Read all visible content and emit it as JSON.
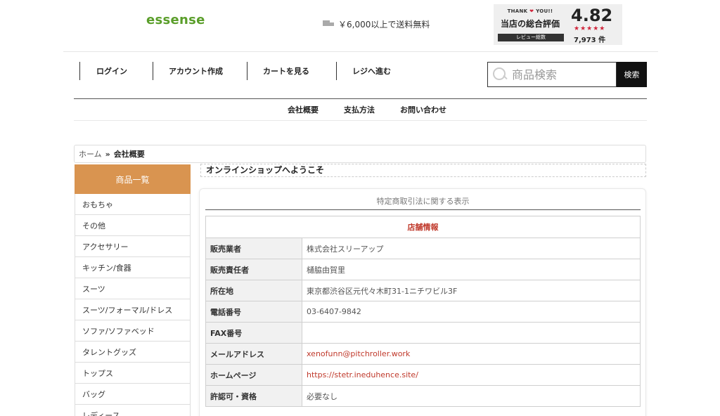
{
  "header": {
    "logo": "essense",
    "shipping": "￥6,000以上で送料無料",
    "badge": {
      "thanks": "THANK",
      "heart": "❤",
      "you": "YOU!!",
      "title": "当店の総合評価",
      "sub": "レビュー総数",
      "score": "4.82",
      "stars": "★★★★★",
      "count": "7,973 件"
    }
  },
  "nav": {
    "items": [
      "ログイン",
      "アカウント作成",
      "カートを見る",
      "レジへ進む"
    ]
  },
  "search": {
    "placeholder": "商品検索",
    "button": "検索"
  },
  "subnav": {
    "items": [
      "会社概要",
      "支払方法",
      "お問い合わせ"
    ]
  },
  "breadcrumb": {
    "home": "ホーム",
    "sep": "»",
    "current": "会社概要"
  },
  "sidebar": {
    "heading": "商品一覧",
    "items": [
      "おもちゃ",
      "その他",
      "アクセサリー",
      "キッチン/食器",
      "スーツ",
      "スーツ/フォーマル/ドレス",
      "ソファ/ソファベッド",
      "タレントグッズ",
      "トップス",
      "バッグ",
      "レディース"
    ]
  },
  "main": {
    "welcome": "オンラインショップへようこそ",
    "panel_title": "特定商取引法に関する表示",
    "table_heading": "店舗情報",
    "rows": [
      {
        "key": "販売業者",
        "value": "株式会社スリーアップ"
      },
      {
        "key": "販売責任者",
        "value": "樋脇由賀里"
      },
      {
        "key": "所在地",
        "value": "東京都渋谷区元代々木町31-1ニチワビル3F"
      },
      {
        "key": "電話番号",
        "value": "03-6407-9842"
      },
      {
        "key": "FAX番号",
        "value": ""
      },
      {
        "key": "メールアドレス",
        "value": "xenofunn@pitchroller.work"
      },
      {
        "key": "ホームページ",
        "value": "https://stetr.ineduhence.site/"
      },
      {
        "key": "許認可・資格",
        "value": "必要なし"
      }
    ]
  },
  "colors": {
    "accent": "#d99450",
    "logo": "#5a9e2a",
    "link": "#c0392b"
  }
}
